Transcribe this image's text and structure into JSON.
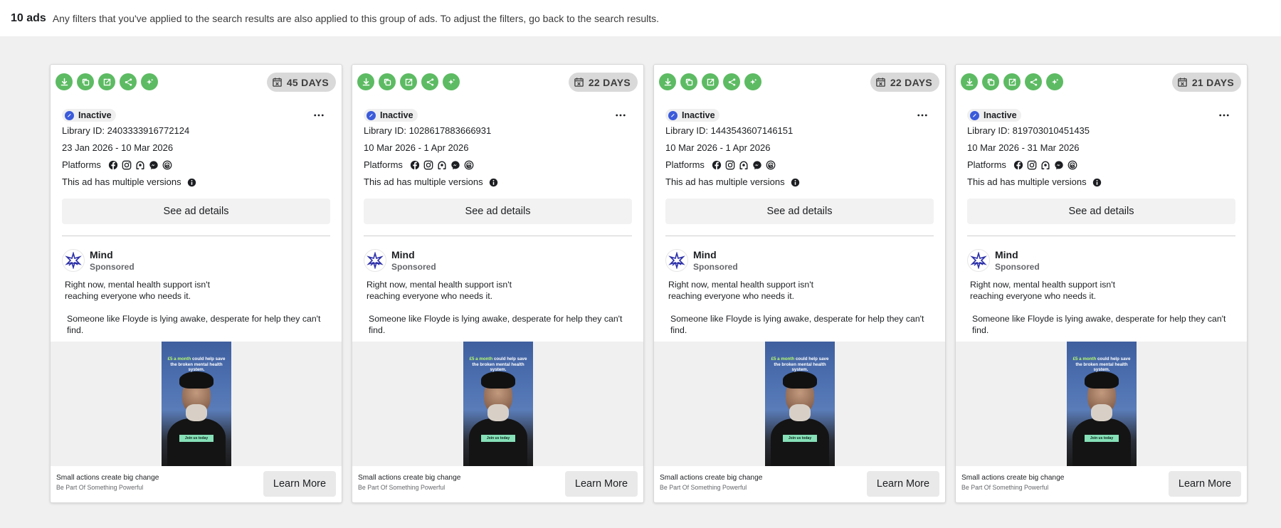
{
  "header": {
    "count": "10 ads",
    "message": "Any filters that you've applied to the search results are also applied to this group of ads. To adjust the filters, go back to the search results."
  },
  "icons": {
    "toolbar": [
      "download-icon",
      "copy-icon",
      "open-external-icon",
      "share-icon",
      "sparkle-icon"
    ],
    "days": "calendar-x-icon",
    "platforms": [
      "facebook-icon",
      "instagram-icon",
      "audience-network-icon",
      "messenger-icon",
      "threads-icon"
    ]
  },
  "colors": {
    "accent_green": "#5dbb63",
    "status_blue": "#3b5bdb",
    "advertiser_logo": "#2b2fa8"
  },
  "cards": [
    {
      "days": "45 DAYS",
      "status": "Inactive",
      "library_id": "Library ID: 2403333916772124",
      "dates": "23 Jan 2026 - 10 Mar 2026",
      "platforms_label": "Platforms",
      "versions_text": "This ad has multiple versions",
      "details_label": "See ad details",
      "advertiser": "Mind",
      "sponsored": "Sponsored",
      "body_1": "Right now, mental health support isn't reaching everyone who needs it.",
      "body_2": "Someone like Floyde is lying awake, desperate for help they can't find.",
      "image_caption_hl": "£5 a month",
      "image_caption": "could help save the broken mental health system.",
      "image_cta": "Join us today",
      "footer_title": "Small actions create big change",
      "footer_sub": "Be Part Of Something Powerful",
      "cta": "Learn More"
    },
    {
      "days": "22 DAYS",
      "status": "Inactive",
      "library_id": "Library ID: 1028617883666931",
      "dates": "10 Mar 2026 - 1 Apr 2026",
      "platforms_label": "Platforms",
      "versions_text": "This ad has multiple versions",
      "details_label": "See ad details",
      "advertiser": "Mind",
      "sponsored": "Sponsored",
      "body_1": "Right now, mental health support isn't reaching everyone who needs it.",
      "body_2": "Someone like Floyde is lying awake, desperate for help they can't find.",
      "image_caption_hl": "£5 a month",
      "image_caption": "could help save the broken mental health system.",
      "image_cta": "Join us today",
      "footer_title": "Small actions create big change",
      "footer_sub": "Be Part Of Something Powerful",
      "cta": "Learn More"
    },
    {
      "days": "22 DAYS",
      "status": "Inactive",
      "library_id": "Library ID: 1443543607146151",
      "dates": "10 Mar 2026 - 1 Apr 2026",
      "platforms_label": "Platforms",
      "versions_text": "This ad has multiple versions",
      "details_label": "See ad details",
      "advertiser": "Mind",
      "sponsored": "Sponsored",
      "body_1": "Right now, mental health support isn't reaching everyone who needs it.",
      "body_2": "Someone like Floyde is lying awake, desperate for help they can't find.",
      "image_caption_hl": "£5 a month",
      "image_caption": "could help save the broken mental health system.",
      "image_cta": "Join us today",
      "footer_title": "Small actions create big change",
      "footer_sub": "Be Part Of Something Powerful",
      "cta": "Learn More"
    },
    {
      "days": "21 DAYS",
      "status": "Inactive",
      "library_id": "Library ID: 819703010451435",
      "dates": "10 Mar 2026 - 31 Mar 2026",
      "platforms_label": "Platforms",
      "versions_text": "This ad has multiple versions",
      "details_label": "See ad details",
      "advertiser": "Mind",
      "sponsored": "Sponsored",
      "body_1": "Right now, mental health support isn't reaching everyone who needs it.",
      "body_2": "Someone like Floyde is lying awake, desperate for help they can't find.",
      "image_caption_hl": "£5 a month",
      "image_caption": "could help save the broken mental health system.",
      "image_cta": "Join us today",
      "footer_title": "Small actions create big change",
      "footer_sub": "Be Part Of Something Powerful",
      "cta": "Learn More"
    }
  ]
}
